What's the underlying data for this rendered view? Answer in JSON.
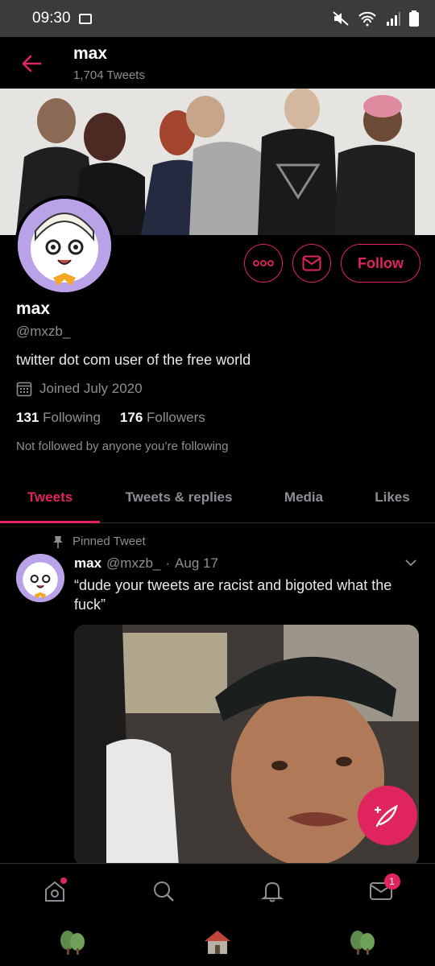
{
  "status_bar": {
    "time": "09:30"
  },
  "header": {
    "name": "max",
    "tweet_count": "1,704 Tweets"
  },
  "profile": {
    "display_name": "max",
    "handle": "@mxzb_",
    "bio": "twitter dot com user of the free world",
    "joined": "Joined July 2020",
    "following_count": "131",
    "following_label": "Following",
    "followers_count": "176",
    "followers_label": "Followers",
    "not_followed_text": "Not followed by anyone you’re following",
    "follow_button": "Follow"
  },
  "tabs": [
    {
      "label": "Tweets",
      "active": true
    },
    {
      "label": "Tweets & replies",
      "active": false
    },
    {
      "label": "Media",
      "active": false
    },
    {
      "label": "Likes",
      "active": false
    }
  ],
  "tweet": {
    "pinned_label": "Pinned Tweet",
    "name": "max",
    "handle": "@mxzb_",
    "separator": "·",
    "date": "Aug 17",
    "text": "“dude your tweets are racist and bigoted what the fuck”"
  },
  "bottom_nav": {
    "messages_badge": "1"
  },
  "colors": {
    "accent": "#e0245e",
    "background": "#000000",
    "muted": "#8b8f94"
  }
}
